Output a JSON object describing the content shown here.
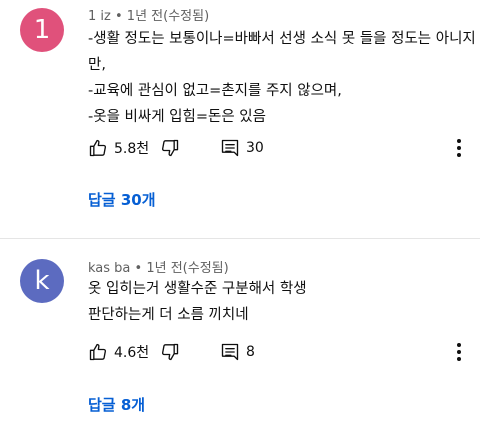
{
  "comments": [
    {
      "avatar_letter": "1",
      "avatar_color": "#e0517b",
      "author": "1 iz",
      "time": "1년 전(수정됨)",
      "lines": [
        "-생활 정도는 보통이나=바빠서 선생 소식 못 들을 정도는 아니지",
        "만,",
        "-교육에 관심이 없고=촌지를 주지 않으며,",
        "-옷을 비싸게 입힘=돈은 있음"
      ],
      "likes": "5.8천",
      "reply_count": "30",
      "replies_label": "답글 30개"
    },
    {
      "avatar_letter": "k",
      "avatar_color": "#5c6bc0",
      "author": "kas ba",
      "time": "1년 전(수정됨)",
      "lines": [
        "옷 입히는거 생활수준 구분해서 학생",
        "판단하는게 더 소름 끼치네"
      ],
      "likes": "4.6천",
      "reply_count": "8",
      "replies_label": "답글 8개"
    }
  ],
  "separator": "•"
}
